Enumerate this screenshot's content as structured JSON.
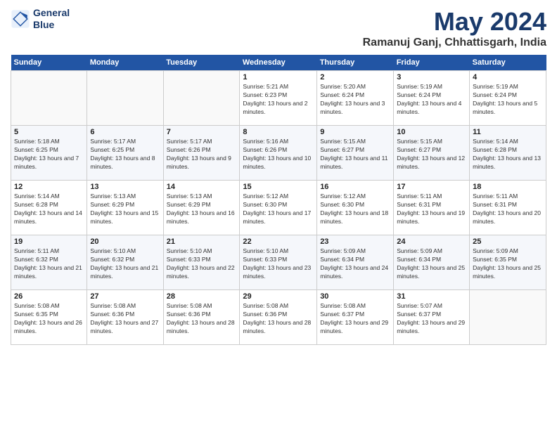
{
  "header": {
    "logo_line1": "General",
    "logo_line2": "Blue",
    "month_title": "May 2024",
    "subtitle": "Ramanuj Ganj, Chhattisgarh, India"
  },
  "days_of_week": [
    "Sunday",
    "Monday",
    "Tuesday",
    "Wednesday",
    "Thursday",
    "Friday",
    "Saturday"
  ],
  "weeks": [
    [
      {
        "day": "",
        "info": ""
      },
      {
        "day": "",
        "info": ""
      },
      {
        "day": "",
        "info": ""
      },
      {
        "day": "1",
        "info": "Sunrise: 5:21 AM\nSunset: 6:23 PM\nDaylight: 13 hours and 2 minutes."
      },
      {
        "day": "2",
        "info": "Sunrise: 5:20 AM\nSunset: 6:24 PM\nDaylight: 13 hours and 3 minutes."
      },
      {
        "day": "3",
        "info": "Sunrise: 5:19 AM\nSunset: 6:24 PM\nDaylight: 13 hours and 4 minutes."
      },
      {
        "day": "4",
        "info": "Sunrise: 5:19 AM\nSunset: 6:24 PM\nDaylight: 13 hours and 5 minutes."
      }
    ],
    [
      {
        "day": "5",
        "info": "Sunrise: 5:18 AM\nSunset: 6:25 PM\nDaylight: 13 hours and 7 minutes."
      },
      {
        "day": "6",
        "info": "Sunrise: 5:17 AM\nSunset: 6:25 PM\nDaylight: 13 hours and 8 minutes."
      },
      {
        "day": "7",
        "info": "Sunrise: 5:17 AM\nSunset: 6:26 PM\nDaylight: 13 hours and 9 minutes."
      },
      {
        "day": "8",
        "info": "Sunrise: 5:16 AM\nSunset: 6:26 PM\nDaylight: 13 hours and 10 minutes."
      },
      {
        "day": "9",
        "info": "Sunrise: 5:15 AM\nSunset: 6:27 PM\nDaylight: 13 hours and 11 minutes."
      },
      {
        "day": "10",
        "info": "Sunrise: 5:15 AM\nSunset: 6:27 PM\nDaylight: 13 hours and 12 minutes."
      },
      {
        "day": "11",
        "info": "Sunrise: 5:14 AM\nSunset: 6:28 PM\nDaylight: 13 hours and 13 minutes."
      }
    ],
    [
      {
        "day": "12",
        "info": "Sunrise: 5:14 AM\nSunset: 6:28 PM\nDaylight: 13 hours and 14 minutes."
      },
      {
        "day": "13",
        "info": "Sunrise: 5:13 AM\nSunset: 6:29 PM\nDaylight: 13 hours and 15 minutes."
      },
      {
        "day": "14",
        "info": "Sunrise: 5:13 AM\nSunset: 6:29 PM\nDaylight: 13 hours and 16 minutes."
      },
      {
        "day": "15",
        "info": "Sunrise: 5:12 AM\nSunset: 6:30 PM\nDaylight: 13 hours and 17 minutes."
      },
      {
        "day": "16",
        "info": "Sunrise: 5:12 AM\nSunset: 6:30 PM\nDaylight: 13 hours and 18 minutes."
      },
      {
        "day": "17",
        "info": "Sunrise: 5:11 AM\nSunset: 6:31 PM\nDaylight: 13 hours and 19 minutes."
      },
      {
        "day": "18",
        "info": "Sunrise: 5:11 AM\nSunset: 6:31 PM\nDaylight: 13 hours and 20 minutes."
      }
    ],
    [
      {
        "day": "19",
        "info": "Sunrise: 5:11 AM\nSunset: 6:32 PM\nDaylight: 13 hours and 21 minutes."
      },
      {
        "day": "20",
        "info": "Sunrise: 5:10 AM\nSunset: 6:32 PM\nDaylight: 13 hours and 21 minutes."
      },
      {
        "day": "21",
        "info": "Sunrise: 5:10 AM\nSunset: 6:33 PM\nDaylight: 13 hours and 22 minutes."
      },
      {
        "day": "22",
        "info": "Sunrise: 5:10 AM\nSunset: 6:33 PM\nDaylight: 13 hours and 23 minutes."
      },
      {
        "day": "23",
        "info": "Sunrise: 5:09 AM\nSunset: 6:34 PM\nDaylight: 13 hours and 24 minutes."
      },
      {
        "day": "24",
        "info": "Sunrise: 5:09 AM\nSunset: 6:34 PM\nDaylight: 13 hours and 25 minutes."
      },
      {
        "day": "25",
        "info": "Sunrise: 5:09 AM\nSunset: 6:35 PM\nDaylight: 13 hours and 25 minutes."
      }
    ],
    [
      {
        "day": "26",
        "info": "Sunrise: 5:08 AM\nSunset: 6:35 PM\nDaylight: 13 hours and 26 minutes."
      },
      {
        "day": "27",
        "info": "Sunrise: 5:08 AM\nSunset: 6:36 PM\nDaylight: 13 hours and 27 minutes."
      },
      {
        "day": "28",
        "info": "Sunrise: 5:08 AM\nSunset: 6:36 PM\nDaylight: 13 hours and 28 minutes."
      },
      {
        "day": "29",
        "info": "Sunrise: 5:08 AM\nSunset: 6:36 PM\nDaylight: 13 hours and 28 minutes."
      },
      {
        "day": "30",
        "info": "Sunrise: 5:08 AM\nSunset: 6:37 PM\nDaylight: 13 hours and 29 minutes."
      },
      {
        "day": "31",
        "info": "Sunrise: 5:07 AM\nSunset: 6:37 PM\nDaylight: 13 hours and 29 minutes."
      },
      {
        "day": "",
        "info": ""
      }
    ]
  ]
}
